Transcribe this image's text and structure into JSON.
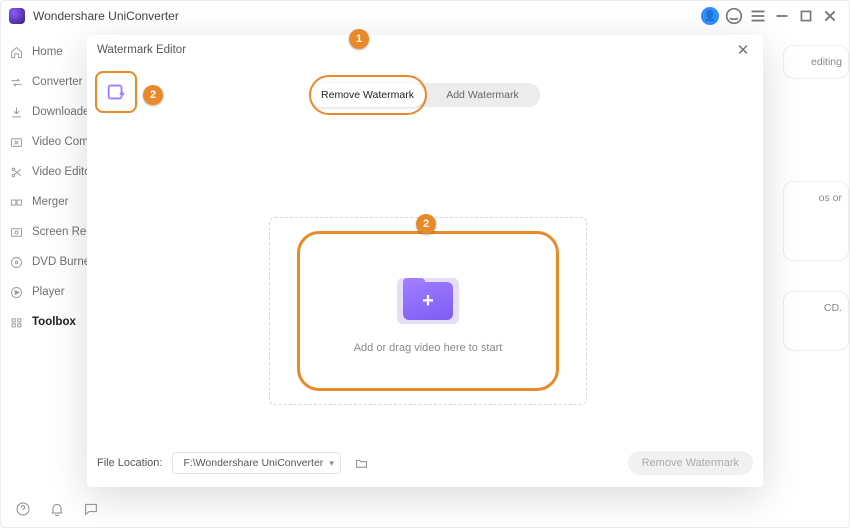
{
  "app": {
    "title": "Wondershare UniConverter"
  },
  "sidebar": {
    "items": [
      {
        "label": "Home"
      },
      {
        "label": "Converter"
      },
      {
        "label": "Downloader"
      },
      {
        "label": "Video Compressor"
      },
      {
        "label": "Video Editor"
      },
      {
        "label": "Merger"
      },
      {
        "label": "Screen Recorder"
      },
      {
        "label": "DVD Burner"
      },
      {
        "label": "Player"
      },
      {
        "label": "Toolbox"
      }
    ]
  },
  "bg_cards": {
    "c1": "editing",
    "c2": "os or",
    "c3": "CD."
  },
  "modal": {
    "title": "Watermark Editor",
    "tabs": {
      "remove": "Remove Watermark",
      "add": "Add Watermark"
    },
    "dropzone_text": "Add or drag video here to start",
    "file_location_label": "File Location:",
    "file_location_path": "F:\\Wondershare UniConverter",
    "action_label": "Remove Watermark"
  },
  "annotations": {
    "one": "1",
    "two_a": "2",
    "two_b": "2"
  }
}
